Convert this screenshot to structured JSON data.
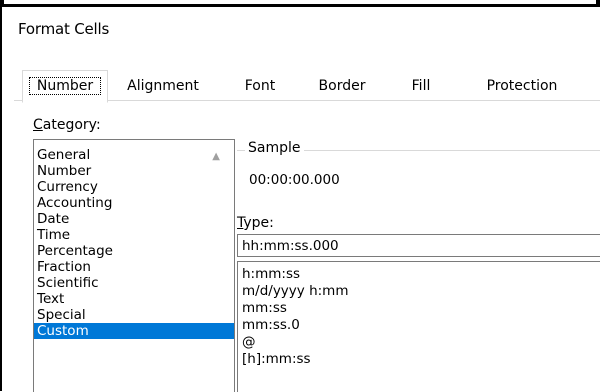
{
  "dialog": {
    "title": "Format Cells"
  },
  "tabs": [
    {
      "label": "Number",
      "active": true
    },
    {
      "label": "Alignment"
    },
    {
      "label": "Font"
    },
    {
      "label": "Border"
    },
    {
      "label": "Fill"
    },
    {
      "label": "Protection"
    }
  ],
  "category": {
    "label_first": "C",
    "label_rest": "ategory:",
    "items": [
      "General",
      "Number",
      "Currency",
      "Accounting",
      "Date",
      "Time",
      "Percentage",
      "Fraction",
      "Scientific",
      "Text",
      "Special",
      "Custom"
    ],
    "selected": "Custom"
  },
  "sample": {
    "label": "Sample",
    "value": "00:00:00.000"
  },
  "type": {
    "label_first": "T",
    "label_rest": "ype:",
    "value": "hh:mm:ss.000",
    "options": [
      "h:mm:ss",
      "m/d/yyyy h:mm",
      "mm:ss",
      "mm:ss.0",
      "@",
      "[h]:mm:ss"
    ]
  },
  "colors": {
    "selection": "#0078d7",
    "border": "#7a7a7a",
    "divider": "#d9d9d9"
  }
}
